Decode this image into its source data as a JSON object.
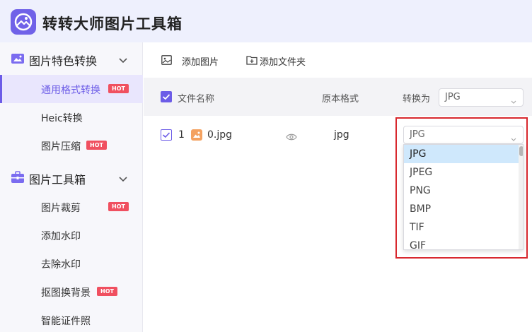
{
  "app": {
    "title": "转转大师图片工具箱"
  },
  "sidebar": {
    "groups": [
      {
        "label": "图片特色转换",
        "items": [
          {
            "label": "通用格式转换",
            "hot": "HOT"
          },
          {
            "label": "Heic转换"
          },
          {
            "label": "图片压缩",
            "hot": "HOT"
          }
        ]
      },
      {
        "label": "图片工具箱",
        "items": [
          {
            "label": "图片裁剪",
            "hot": "HOT"
          },
          {
            "label": "添加水印"
          },
          {
            "label": "去除水印"
          },
          {
            "label": "抠图换背景",
            "hot": "HOT"
          },
          {
            "label": "智能证件照"
          }
        ]
      }
    ]
  },
  "toolbar": {
    "add_image": "添加图片",
    "add_folder": "添加文件夹"
  },
  "table": {
    "headers": {
      "filename": "文件名称",
      "original_format": "原本格式",
      "convert_to": "转换为"
    },
    "global_format": "JPG",
    "rows": [
      {
        "index": "1",
        "filename": "0.jpg",
        "format": "jpg",
        "target": "JPG"
      }
    ]
  },
  "dropdown": {
    "options": [
      "JPG",
      "JPEG",
      "PNG",
      "BMP",
      "TIF",
      "GIF"
    ],
    "selected": "JPG"
  },
  "colors": {
    "accent": "#6c5ce7",
    "hot": "#f05060",
    "highlight": "#d8282e"
  }
}
